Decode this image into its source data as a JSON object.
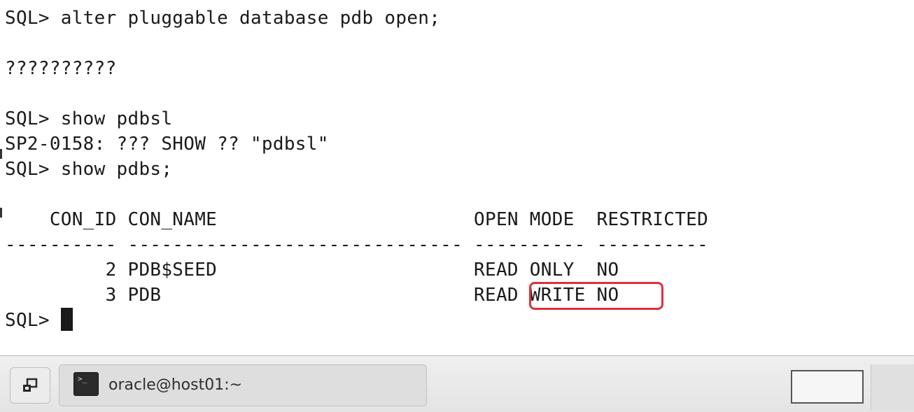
{
  "terminal": {
    "lines": [
      "SQL> alter pluggable database pdb open;",
      "",
      "??????????",
      "",
      "SQL> show pdbsl",
      "SP2-0158: ??? SHOW ?? \"pdbsl\"",
      "SQL> show pdbs;",
      "",
      "    CON_ID CON_NAME                       OPEN MODE  RESTRICTED",
      "---------- ------------------------------ ---------- ----------",
      "         2 PDB$SEED                       READ ONLY  NO",
      "         3 PDB                            READ WRITE NO"
    ],
    "prompt": "SQL> ",
    "highlighted_value": "READ WRITE"
  },
  "taskbar": {
    "show_desktop_icon": "window-restore-icon",
    "task_label": "oracle@host01:~",
    "task_icon": "terminal-icon",
    "terminal_icon_glyph": ">_"
  },
  "colors": {
    "highlight": "#e0303a",
    "text": "#1a1a1a"
  }
}
